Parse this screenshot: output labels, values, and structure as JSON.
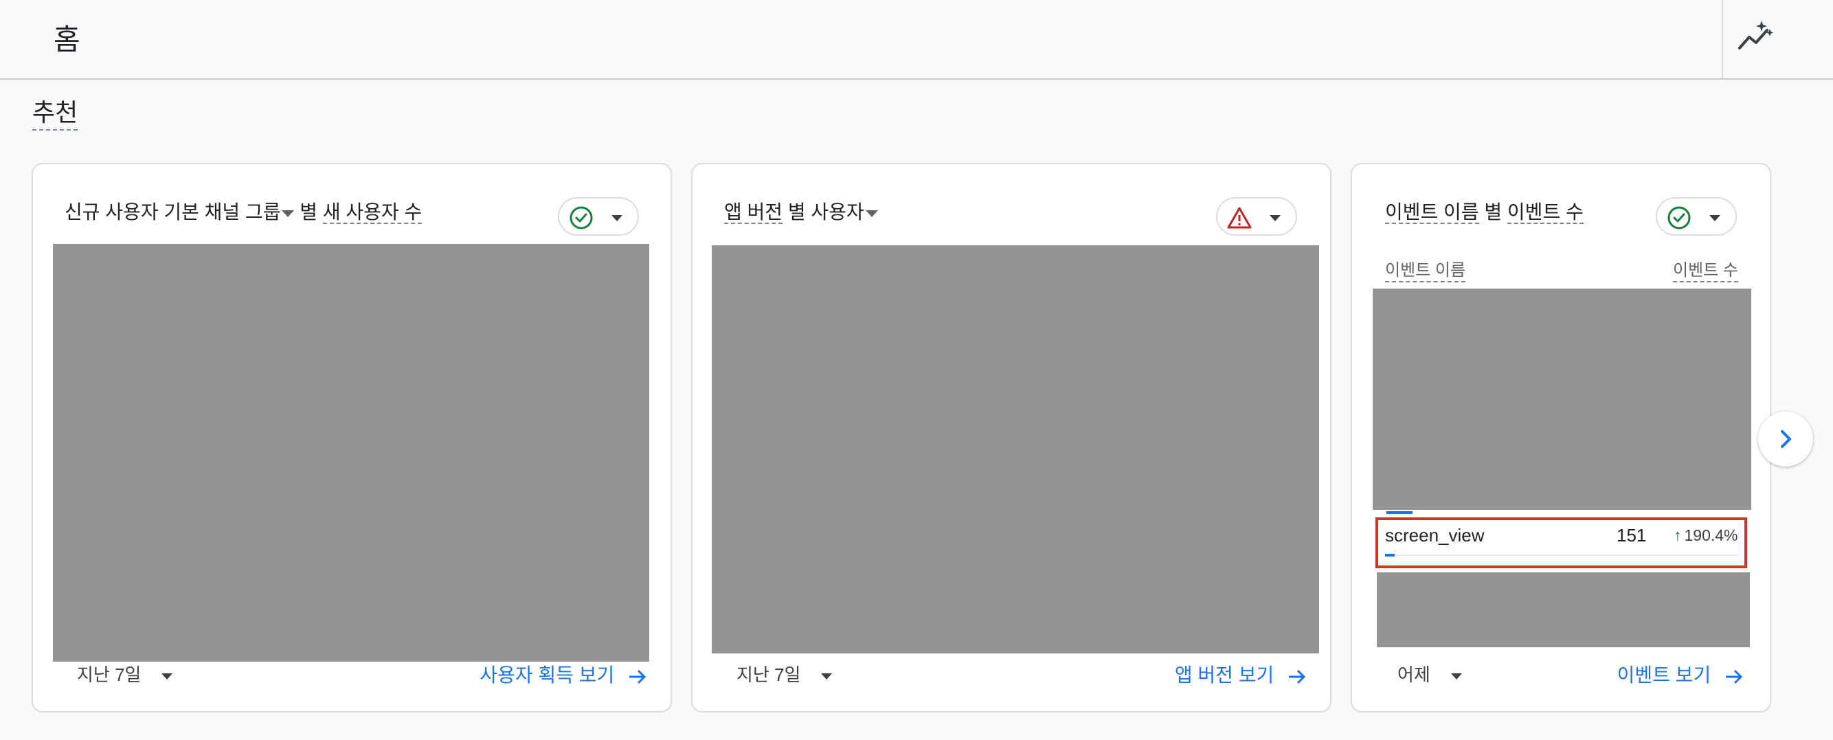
{
  "header": {
    "title": "홈",
    "insights_icon": "insights-sparkle-icon"
  },
  "section": {
    "title": "추천"
  },
  "cards": [
    {
      "title_dimension": "신규 사용자 기본 채널 그룹",
      "title_joiner": "별",
      "title_metric": "새 사용자 수",
      "status": "ok",
      "status_icon": "check-circle-icon",
      "period": "지난 7일",
      "link": "사용자 획득 보기"
    },
    {
      "title_dimension": "앱 버전",
      "title_joiner": "별",
      "title_metric": "사용자",
      "status": "warning",
      "status_icon": "warning-triangle-icon",
      "period": "지난 7일",
      "link": "앱 버전 보기"
    },
    {
      "title_dimension": "이벤트 이름",
      "title_joiner": "별",
      "title_metric": "이벤트 수",
      "status": "ok",
      "status_icon": "check-circle-icon",
      "col_dimension": "이벤트 이름",
      "col_metric": "이벤트 수",
      "row": {
        "name": "screen_view",
        "value": "151",
        "change": "190.4%",
        "share": 0.02
      },
      "period": "어제",
      "link": "이벤트 보기"
    }
  ],
  "colors": {
    "link": "#1a73e8",
    "ok": "#188038",
    "warning": "#c5221f",
    "highlight": "#d93025",
    "placeholder": "#949494"
  }
}
